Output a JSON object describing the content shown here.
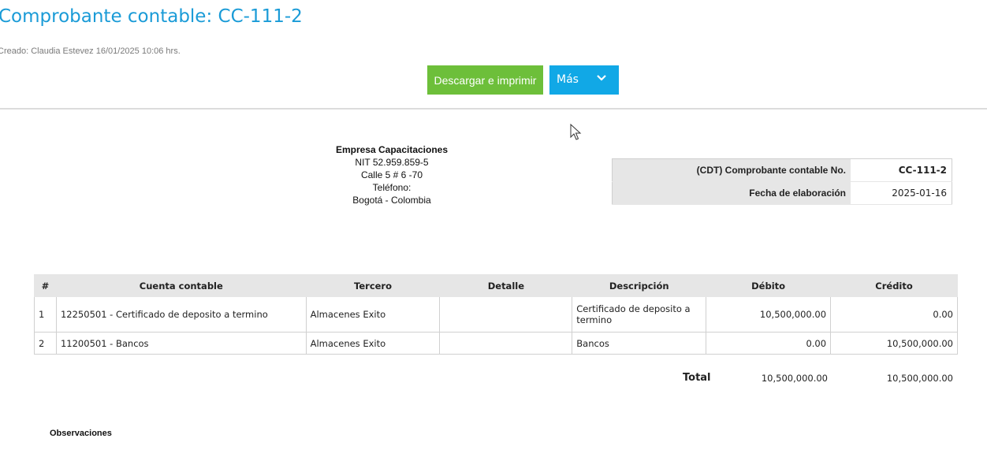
{
  "header": {
    "title": "Comprobante contable: CC-111-2",
    "created": "Creado: Claudia Estevez 16/01/2025 10:06 hrs."
  },
  "actions": {
    "download_label": "Descargar e imprimir",
    "more_label": "Más"
  },
  "company": {
    "name": "Empresa Capacitaciones",
    "nit": "NIT 52.959.859-5",
    "address": "Calle 5 # 6 -70",
    "phone": "Teléfono:",
    "city": "Bogotá - Colombia"
  },
  "voucher": {
    "number_label": "(CDT) Comprobante contable No.",
    "number_value": "CC-111-2",
    "date_label": "Fecha de elaboración",
    "date_value": "2025-01-16"
  },
  "entries": {
    "columns": [
      "#",
      "Cuenta contable",
      "Tercero",
      "Detalle",
      "Descripción",
      "Débito",
      "Crédito"
    ],
    "rows": [
      {
        "num": "1",
        "account": "12250501 - Certificado de deposito a termino",
        "third_party": "Almacenes Exito",
        "detail": "",
        "description": "Certificado de deposito a termino",
        "debit": "10,500,000.00",
        "credit": "0.00"
      },
      {
        "num": "2",
        "account": "11200501 - Bancos",
        "third_party": "Almacenes Exito",
        "detail": "",
        "description": "Bancos",
        "debit": "0.00",
        "credit": "10,500,000.00"
      }
    ],
    "total_label": "Total",
    "total_debit": "10,500,000.00",
    "total_credit": "10,500,000.00"
  },
  "observations_label": "Observaciones",
  "colors": {
    "title": "#1a9bd7",
    "download_button": "#6dbf3a",
    "more_button": "#11a8e6",
    "table_header": "#e6e6e6"
  },
  "icons": [
    "chevron-down-icon",
    "mouse-cursor-icon"
  ]
}
